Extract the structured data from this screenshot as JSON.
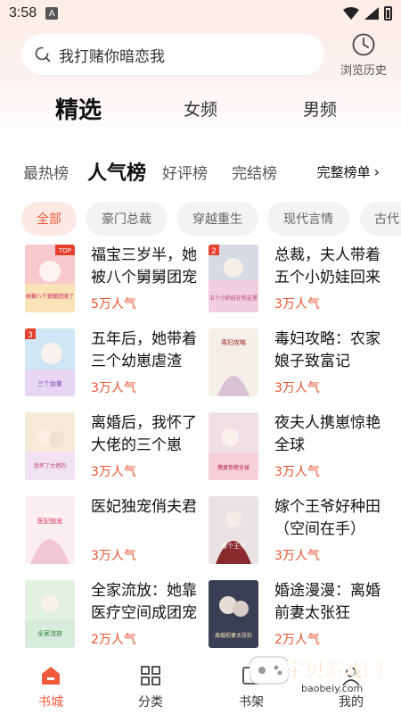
{
  "status_bar": {
    "time": "3:58",
    "notif_icon": "A"
  },
  "search": {
    "text": "我打赌你暗恋我"
  },
  "history": {
    "label": "浏览历史"
  },
  "main_tabs": [
    {
      "label": "精选",
      "active": true
    },
    {
      "label": "女频",
      "active": false
    },
    {
      "label": "男频",
      "active": false
    }
  ],
  "sub_tabs": [
    {
      "label": "最热榜",
      "active": false
    },
    {
      "label": "人气榜",
      "active": true
    },
    {
      "label": "好评榜",
      "active": false
    },
    {
      "label": "完结榜",
      "active": false
    }
  ],
  "full_list_label": "完整榜单",
  "chips": [
    {
      "label": "全部",
      "active": true
    },
    {
      "label": "豪门总裁",
      "active": false
    },
    {
      "label": "穿越重生",
      "active": false
    },
    {
      "label": "现代言情",
      "active": false
    },
    {
      "label": "古代",
      "active": false
    }
  ],
  "books": [
    {
      "title": "福宝三岁半，她被八个舅舅团宠了",
      "popularity": "5万人气",
      "badge": "TOP",
      "cover_text": "她被八个舅舅团宠了"
    },
    {
      "title": "总裁，夫人带着五个小奶娃回来了",
      "popularity": "3万人气",
      "badge": "2",
      "cover_text": "五个小奶娃在你这里"
    },
    {
      "title": "五年后，她带着三个幼崽虐渣",
      "popularity": "3万人气",
      "badge": "3",
      "cover_text": "三个幼崽"
    },
    {
      "title": "毒妇攻略：农家娘子致富记",
      "popularity": "3万人气",
      "badge": "",
      "cover_text": "毒妇攻略"
    },
    {
      "title": "离婚后，我怀了大佬的三个崽",
      "popularity": "3万人气",
      "badge": "",
      "cover_text": "我怀了大佬的"
    },
    {
      "title": "夜夫人携崽惊艳全球",
      "popularity": "3万人气",
      "badge": "",
      "cover_text": "携崽惊艳全球"
    },
    {
      "title": "医妃独宠俏夫君",
      "popularity": "3万人气",
      "badge": "",
      "cover_text": "医妃独宠"
    },
    {
      "title": "嫁个王爷好种田（空间在手）",
      "popularity": "3万人气",
      "badge": "",
      "cover_text": "嫁个王爷"
    },
    {
      "title": "全家流放：她靠医疗空间成团宠",
      "popularity": "2万人气",
      "badge": "",
      "cover_text": "全家流放"
    },
    {
      "title": "婚途漫漫：离婚前妻太张狂",
      "popularity": "2万人气",
      "badge": "",
      "cover_text": "离婚前妻太张狂"
    }
  ],
  "bottom_nav": [
    {
      "label": "书城",
      "active": true,
      "icon": "home-icon"
    },
    {
      "label": "分类",
      "active": false,
      "icon": "grid-icon"
    },
    {
      "label": "书架",
      "active": false,
      "icon": "shelf-icon"
    },
    {
      "label": "我的",
      "active": false,
      "icon": "user-icon"
    }
  ],
  "watermark": {
    "title": "宝贝游戏网",
    "url": "baobeiy.com"
  },
  "colors": {
    "accent": "#ef5a3c",
    "popularity": "#e8532f"
  }
}
